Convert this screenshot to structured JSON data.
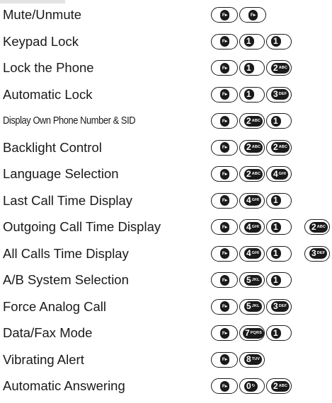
{
  "rows": [
    {
      "label": "Mute/Unmute",
      "keys": [
        {
          "num": "F",
          "sub": ""
        },
        {
          "num": "F",
          "sub": ""
        }
      ]
    },
    {
      "label": "Keypad Lock",
      "keys": [
        {
          "num": "F",
          "sub": ""
        },
        {
          "num": "1",
          "sub": ""
        },
        {
          "num": "1",
          "sub": ""
        }
      ]
    },
    {
      "label": "Lock the Phone",
      "keys": [
        {
          "num": "F",
          "sub": ""
        },
        {
          "num": "1",
          "sub": ""
        },
        {
          "num": "2",
          "sub": "ABC"
        }
      ]
    },
    {
      "label": "Automatic Lock",
      "keys": [
        {
          "num": "F",
          "sub": ""
        },
        {
          "num": "1",
          "sub": ""
        },
        {
          "num": "3",
          "sub": "DEF"
        }
      ]
    },
    {
      "label": "Display Own Phone Number & SID",
      "keys": [
        {
          "num": "F",
          "sub": ""
        },
        {
          "num": "2",
          "sub": "ABC"
        },
        {
          "num": "1",
          "sub": ""
        }
      ]
    },
    {
      "label": "Backlight Control",
      "keys": [
        {
          "num": "F",
          "sub": ""
        },
        {
          "num": "2",
          "sub": "ABC"
        },
        {
          "num": "2",
          "sub": "ABC"
        }
      ]
    },
    {
      "label": "Language Selection",
      "keys": [
        {
          "num": "F",
          "sub": ""
        },
        {
          "num": "2",
          "sub": "ABC"
        },
        {
          "num": "4",
          "sub": "GHI"
        }
      ]
    },
    {
      "label": "Last Call Time Display",
      "keys": [
        {
          "num": "F",
          "sub": ""
        },
        {
          "num": "4",
          "sub": "GHI"
        },
        {
          "num": "1",
          "sub": ""
        }
      ]
    },
    {
      "label": "Outgoing Call Time Display",
      "keys": [
        {
          "num": "F",
          "sub": ""
        },
        {
          "num": "4",
          "sub": "GHI"
        },
        {
          "num": "1",
          "sub": ""
        },
        {
          "num": "2",
          "sub": "ABC"
        }
      ]
    },
    {
      "label": "All Calls Time Display",
      "keys": [
        {
          "num": "F",
          "sub": ""
        },
        {
          "num": "4",
          "sub": "GHI"
        },
        {
          "num": "1",
          "sub": ""
        },
        {
          "num": "3",
          "sub": "DEF"
        }
      ]
    },
    {
      "label": "A/B System Selection",
      "keys": [
        {
          "num": "F",
          "sub": ""
        },
        {
          "num": "5",
          "sub": "JKL"
        },
        {
          "num": "1",
          "sub": ""
        }
      ]
    },
    {
      "label": "Force Analog Call",
      "keys": [
        {
          "num": "F",
          "sub": ""
        },
        {
          "num": "5",
          "sub": "JKL"
        },
        {
          "num": "3",
          "sub": "DEF"
        }
      ]
    },
    {
      "label": "Data/Fax Mode",
      "keys": [
        {
          "num": "F",
          "sub": ""
        },
        {
          "num": "7",
          "sub": "PQRS"
        },
        {
          "num": "1",
          "sub": ""
        }
      ]
    },
    {
      "label": "Vibrating Alert",
      "keys": [
        {
          "num": "F",
          "sub": ""
        },
        {
          "num": "8",
          "sub": "TUV"
        }
      ]
    },
    {
      "label": "Automatic Answering",
      "keys": [
        {
          "num": "F",
          "sub": ""
        },
        {
          "num": "0",
          "sub": "↻"
        },
        {
          "num": "2",
          "sub": "ABC"
        }
      ]
    }
  ],
  "icons": {
    "function_key": "function-key-icon",
    "digit_key": "digit-key-icon"
  },
  "colors": {
    "text": "#1a1a1a",
    "key_fill": "#1a1a1a",
    "key_glyph": "#ffffff",
    "header_tab": "#e3e3e3"
  }
}
